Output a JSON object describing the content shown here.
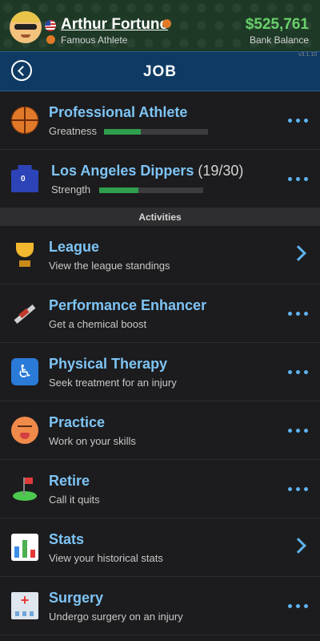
{
  "profile": {
    "name": "Arthur Fortune",
    "job": "Famous Athlete",
    "balance": "$525,761",
    "balance_label": "Bank Balance",
    "version": "v3.1.10"
  },
  "header": {
    "title": "JOB"
  },
  "jobs": [
    {
      "icon": "basketball-icon",
      "title": "Professional Athlete",
      "extra": "",
      "stat_label": "Greatness",
      "progress": 0.35
    },
    {
      "icon": "jersey-icon",
      "jersey_number": "0",
      "title": "Los Angeles Dippers",
      "extra": " (19/30)",
      "stat_label": "Strength",
      "progress": 0.38
    }
  ],
  "section_label": "Activities",
  "activities": [
    {
      "icon": "trophy-icon",
      "title": "League",
      "sub": "View the league standings",
      "action": "chevron"
    },
    {
      "icon": "syringe-icon",
      "title": "Performance Enhancer",
      "sub": "Get a chemical boost",
      "action": "more"
    },
    {
      "icon": "wheelchair-icon",
      "title": "Physical Therapy",
      "sub": "Seek treatment for an injury",
      "action": "more"
    },
    {
      "icon": "hot-face-icon",
      "title": "Practice",
      "sub": "Work on your skills",
      "action": "more"
    },
    {
      "icon": "golf-flag-icon",
      "title": "Retire",
      "sub": "Call it quits",
      "action": "more"
    },
    {
      "icon": "bar-chart-icon",
      "title": "Stats",
      "sub": "View your historical stats",
      "action": "chevron"
    },
    {
      "icon": "hospital-icon",
      "title": "Surgery",
      "sub": "Undergo surgery on an injury",
      "action": "more"
    }
  ],
  "colors": {
    "accent": "#7ec4f5",
    "money": "#68d06a",
    "progress": "#2f9e4d",
    "header": "#0e3a63"
  }
}
